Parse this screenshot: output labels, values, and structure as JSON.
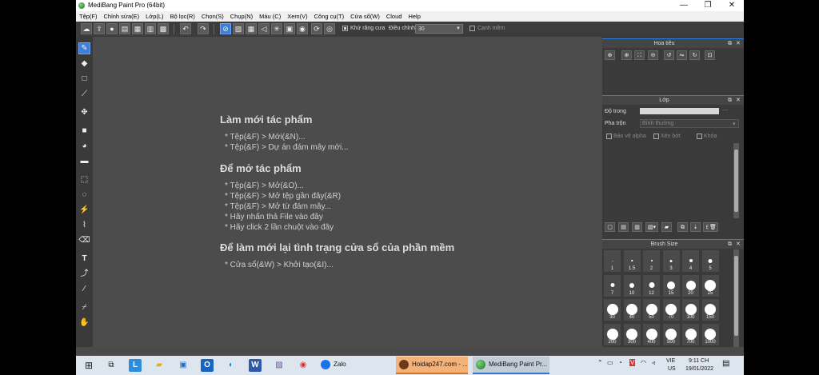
{
  "window": {
    "title": "MediBang Paint Pro (64bit)",
    "min": "—",
    "max": "❐",
    "close": "✕"
  },
  "menu": [
    "Tệp(F)",
    "Chỉnh sửa(E)",
    "Lớp(L)",
    "Bộ lọc(R)",
    "Chọn(S)",
    "Chụp(N)",
    "Màu (C)",
    "Xem(V)",
    "Công cụ(T)",
    "Cửa sổ(W)",
    "Cloud",
    "Help"
  ],
  "toolbar": {
    "antialias_label": "Khử răng cưa",
    "antialias_checked": true,
    "adjust_label": "Điều chỉnh",
    "adjust_value": "30",
    "edge_label": "Cạnh mềm",
    "edge_checked": false
  },
  "canvas": {
    "new_heading": "Làm mới tác phẩm",
    "new_items": [
      "* Tệp(&F) > Mới(&N)...",
      "* Tệp(&F) > Dự án đám mây mới..."
    ],
    "open_heading": "Để mở tác phẩm",
    "open_items": [
      "* Tệp(&F) > Mở(&O)...",
      "* Tệp(&F) > Mở tệp gần đây(&R)",
      "* Tệp(&F) > Mở từ đám mây...",
      "* Hãy nhấn thả File vào đây",
      "* Hãy click 2 lần chuột vào đây"
    ],
    "reset_heading": "Để làm mới lại tình trạng cửa sổ của phần mềm",
    "reset_items": [
      "* Cửa sổ(&W) > Khởi tạo(&I)..."
    ]
  },
  "panels": {
    "navigator_title": "Hoa tiêu",
    "layer_title": "Lớp",
    "opacity_label": "Độ trong",
    "opacity_value": "---",
    "blend_label": "Pha trộn",
    "blend_value": "Bình thường",
    "protect_alpha": "Bảo vệ alpha",
    "clipping": "Xén bớt",
    "lock": "Khóa",
    "brush_size_title": "Brush Size",
    "brush_sizes": [
      "1",
      "1.5",
      "2",
      "3",
      "4",
      "5",
      "7",
      "10",
      "12",
      "15",
      "20",
      "25",
      "30",
      "40",
      "50",
      "70",
      "100",
      "150",
      "200",
      "300",
      "400",
      "500",
      "700",
      "1000"
    ]
  },
  "taskbar": {
    "zalo": "Zalo",
    "hoidap": "Hoidap247.com - ...",
    "medibang": "MediBang Paint Pr...",
    "lang": "VIE",
    "region": "US",
    "time": "9:11 CH",
    "date": "19/01/2022"
  }
}
